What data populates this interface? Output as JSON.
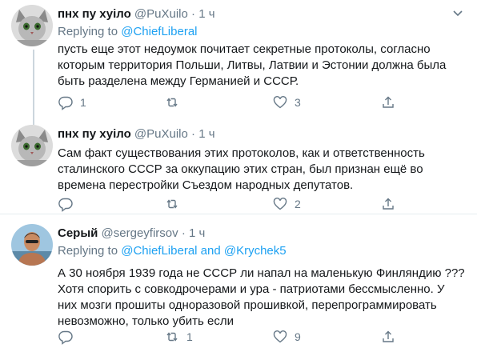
{
  "tweets": [
    {
      "name": "пнх пу хуіло",
      "handle": "@PuXuilo",
      "dot": "·",
      "time": "1 ч",
      "replying_prefix": "Replying to ",
      "replying_to": "@ChiefLiberal",
      "text": "пусть еще этот недоумок почитает секретные протоколы, согласно\nкоторым территория Польши, Литвы, Латвии и Эстонии должна была\nбыть разделена между Германией и СССР.",
      "replies": "1",
      "retweets": "",
      "likes": "3",
      "avatar": "cat-avatar"
    },
    {
      "name": "пнх пу хуіло",
      "handle": "@PuXuilo",
      "dot": "·",
      "time": "1 ч",
      "text": "Сам факт существования этих протоколов, как и ответственность\nсталинского СССР за оккупацию этих стран, был признан ещё во\nвремена перестройки Съездом народных депутатов.",
      "replies": "",
      "retweets": "",
      "likes": "2",
      "avatar": "cat-avatar"
    },
    {
      "name": "Серый",
      "handle": "@sergeyfirsov",
      "dot": "·",
      "time": "1 ч",
      "replying_prefix": "Replying to ",
      "replying_to": "@ChiefLiberal and @Krychek5",
      "text": "А 30 ноября 1939 года не СССР ли напал на маленькую Финляндию ???\nХотя спорить с совкодрочерами и ура - патриотами бессмысленно. У\nних мозги прошиты одноразовой прошивкой, перепрограммировать\nневозможно, только убить если",
      "replies": "",
      "retweets": "1",
      "likes": "9",
      "avatar": "man-avatar"
    }
  ],
  "colors": {
    "text": "#14171a",
    "secondary": "#657786",
    "link": "#1da1f2",
    "divider": "#e6ecf0",
    "thread_line": "#ccd6dd"
  }
}
